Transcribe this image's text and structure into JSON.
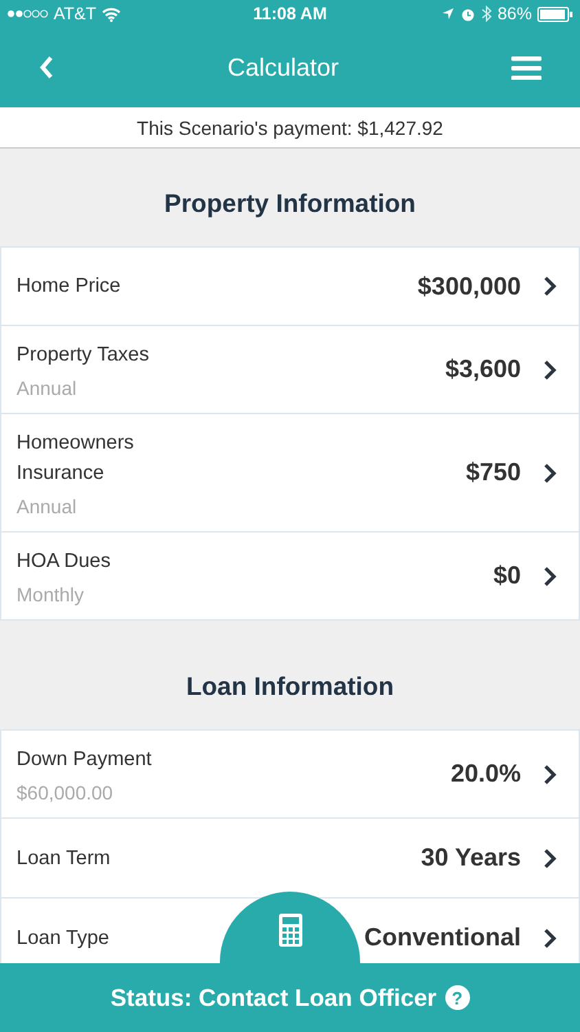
{
  "status_bar": {
    "carrier": "AT&T",
    "time": "11:08 AM",
    "battery": "86%"
  },
  "nav": {
    "title": "Calculator"
  },
  "payment_banner": "This Scenario's payment: $1,427.92",
  "sections": [
    {
      "title": "Property Information",
      "rows": [
        {
          "label": "Home Price",
          "value": "$300,000"
        },
        {
          "label": "Property Taxes",
          "sublabel": "Annual",
          "value": "$3,600"
        },
        {
          "label": "Homeowners Insurance",
          "sublabel": "Annual",
          "value": "$750"
        },
        {
          "label": "HOA Dues",
          "sublabel": "Monthly",
          "value": "$0"
        }
      ]
    },
    {
      "title": "Loan Information",
      "rows": [
        {
          "label": "Down Payment",
          "sublabel": "$60,000.00",
          "value": "20.0%"
        },
        {
          "label": "Loan Term",
          "value": "30 Years"
        },
        {
          "label": "Loan Type",
          "value": "Conventional"
        }
      ]
    }
  ],
  "bottom_bar": {
    "status": "Status: Contact Loan Officer",
    "help": "?"
  }
}
